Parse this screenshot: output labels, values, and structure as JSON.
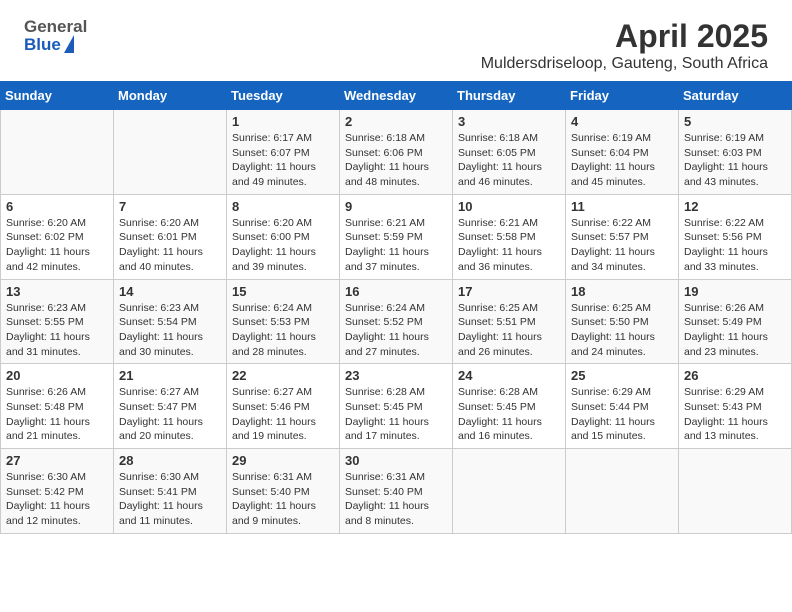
{
  "header": {
    "logo_line1": "General",
    "logo_line2": "Blue",
    "month": "April 2025",
    "location": "Muldersdriseloop, Gauteng, South Africa"
  },
  "days_of_week": [
    "Sunday",
    "Monday",
    "Tuesday",
    "Wednesday",
    "Thursday",
    "Friday",
    "Saturday"
  ],
  "weeks": [
    [
      {
        "day": "",
        "info": ""
      },
      {
        "day": "",
        "info": ""
      },
      {
        "day": "1",
        "info": "Sunrise: 6:17 AM\nSunset: 6:07 PM\nDaylight: 11 hours and 49 minutes."
      },
      {
        "day": "2",
        "info": "Sunrise: 6:18 AM\nSunset: 6:06 PM\nDaylight: 11 hours and 48 minutes."
      },
      {
        "day": "3",
        "info": "Sunrise: 6:18 AM\nSunset: 6:05 PM\nDaylight: 11 hours and 46 minutes."
      },
      {
        "day": "4",
        "info": "Sunrise: 6:19 AM\nSunset: 6:04 PM\nDaylight: 11 hours and 45 minutes."
      },
      {
        "day": "5",
        "info": "Sunrise: 6:19 AM\nSunset: 6:03 PM\nDaylight: 11 hours and 43 minutes."
      }
    ],
    [
      {
        "day": "6",
        "info": "Sunrise: 6:20 AM\nSunset: 6:02 PM\nDaylight: 11 hours and 42 minutes."
      },
      {
        "day": "7",
        "info": "Sunrise: 6:20 AM\nSunset: 6:01 PM\nDaylight: 11 hours and 40 minutes."
      },
      {
        "day": "8",
        "info": "Sunrise: 6:20 AM\nSunset: 6:00 PM\nDaylight: 11 hours and 39 minutes."
      },
      {
        "day": "9",
        "info": "Sunrise: 6:21 AM\nSunset: 5:59 PM\nDaylight: 11 hours and 37 minutes."
      },
      {
        "day": "10",
        "info": "Sunrise: 6:21 AM\nSunset: 5:58 PM\nDaylight: 11 hours and 36 minutes."
      },
      {
        "day": "11",
        "info": "Sunrise: 6:22 AM\nSunset: 5:57 PM\nDaylight: 11 hours and 34 minutes."
      },
      {
        "day": "12",
        "info": "Sunrise: 6:22 AM\nSunset: 5:56 PM\nDaylight: 11 hours and 33 minutes."
      }
    ],
    [
      {
        "day": "13",
        "info": "Sunrise: 6:23 AM\nSunset: 5:55 PM\nDaylight: 11 hours and 31 minutes."
      },
      {
        "day": "14",
        "info": "Sunrise: 6:23 AM\nSunset: 5:54 PM\nDaylight: 11 hours and 30 minutes."
      },
      {
        "day": "15",
        "info": "Sunrise: 6:24 AM\nSunset: 5:53 PM\nDaylight: 11 hours and 28 minutes."
      },
      {
        "day": "16",
        "info": "Sunrise: 6:24 AM\nSunset: 5:52 PM\nDaylight: 11 hours and 27 minutes."
      },
      {
        "day": "17",
        "info": "Sunrise: 6:25 AM\nSunset: 5:51 PM\nDaylight: 11 hours and 26 minutes."
      },
      {
        "day": "18",
        "info": "Sunrise: 6:25 AM\nSunset: 5:50 PM\nDaylight: 11 hours and 24 minutes."
      },
      {
        "day": "19",
        "info": "Sunrise: 6:26 AM\nSunset: 5:49 PM\nDaylight: 11 hours and 23 minutes."
      }
    ],
    [
      {
        "day": "20",
        "info": "Sunrise: 6:26 AM\nSunset: 5:48 PM\nDaylight: 11 hours and 21 minutes."
      },
      {
        "day": "21",
        "info": "Sunrise: 6:27 AM\nSunset: 5:47 PM\nDaylight: 11 hours and 20 minutes."
      },
      {
        "day": "22",
        "info": "Sunrise: 6:27 AM\nSunset: 5:46 PM\nDaylight: 11 hours and 19 minutes."
      },
      {
        "day": "23",
        "info": "Sunrise: 6:28 AM\nSunset: 5:45 PM\nDaylight: 11 hours and 17 minutes."
      },
      {
        "day": "24",
        "info": "Sunrise: 6:28 AM\nSunset: 5:45 PM\nDaylight: 11 hours and 16 minutes."
      },
      {
        "day": "25",
        "info": "Sunrise: 6:29 AM\nSunset: 5:44 PM\nDaylight: 11 hours and 15 minutes."
      },
      {
        "day": "26",
        "info": "Sunrise: 6:29 AM\nSunset: 5:43 PM\nDaylight: 11 hours and 13 minutes."
      }
    ],
    [
      {
        "day": "27",
        "info": "Sunrise: 6:30 AM\nSunset: 5:42 PM\nDaylight: 11 hours and 12 minutes."
      },
      {
        "day": "28",
        "info": "Sunrise: 6:30 AM\nSunset: 5:41 PM\nDaylight: 11 hours and 11 minutes."
      },
      {
        "day": "29",
        "info": "Sunrise: 6:31 AM\nSunset: 5:40 PM\nDaylight: 11 hours and 9 minutes."
      },
      {
        "day": "30",
        "info": "Sunrise: 6:31 AM\nSunset: 5:40 PM\nDaylight: 11 hours and 8 minutes."
      },
      {
        "day": "",
        "info": ""
      },
      {
        "day": "",
        "info": ""
      },
      {
        "day": "",
        "info": ""
      }
    ]
  ]
}
